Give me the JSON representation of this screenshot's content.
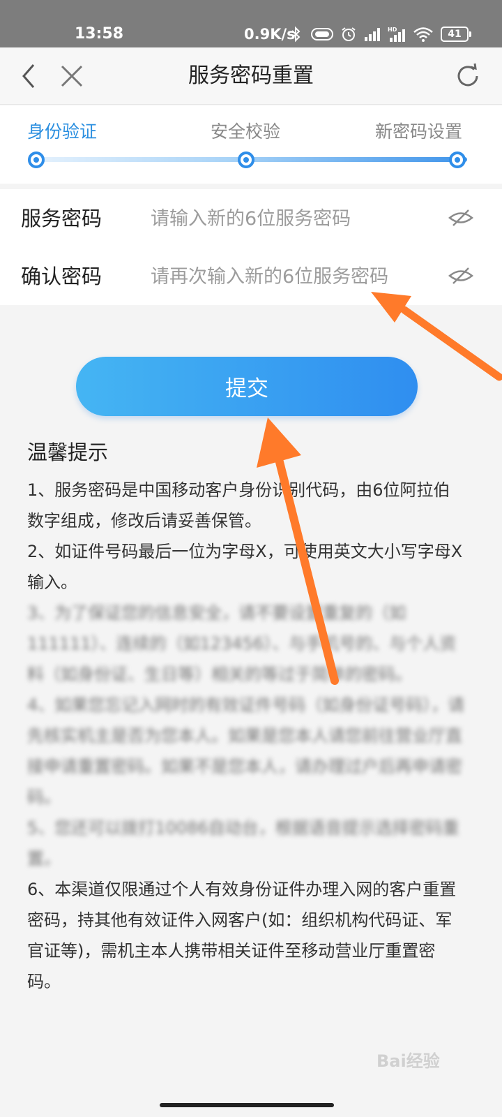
{
  "status_bar": {
    "time": "13:58",
    "network_speed": "0.9K/s",
    "battery_level": "41"
  },
  "nav": {
    "title": "服务密码重置",
    "back_icon": "chevron-left-icon",
    "close_icon": "close-icon",
    "refresh_icon": "refresh-icon"
  },
  "steps": {
    "items": [
      {
        "label": "身份验证",
        "active": true
      },
      {
        "label": "安全校验",
        "active": false
      },
      {
        "label": "新密码设置",
        "active": false
      }
    ],
    "active_color": "#2b8fe0"
  },
  "form": {
    "password": {
      "label": "服务密码",
      "placeholder": "请输入新的6位服务密码",
      "value": ""
    },
    "confirm": {
      "label": "确认密码",
      "placeholder": "请再次输入新的6位服务密码",
      "value": ""
    }
  },
  "submit_label": "提交",
  "tips": {
    "title": "温馨提示",
    "items": [
      "1、服务密码是中国移动客户身份识别代码，由6位阿拉伯数字组成，修改后请妥善保管。",
      "2、如证件号码最后一位为字母X，可使用英文大小写字母X输入。",
      "3、为了保证您的信息安全，请不要设置重复的（如111111）、连续的（如123456）、与手机号的、与个人资料（如身份证、生日等）相关的等过于简单的密码。",
      "4、如果您忘记入网时的有效证件号码（如身份证号码），请先核实机主是否为您本人。如果是您本人请您前往营业厅直接申请重置密码。如果不是您本人，请办理过户后再申请密码。",
      "5、您还可以拨打10086自动台，根据语音提示选择密码重置。",
      "6、本渠道仅限通过个人有效身份证件办理入网的客户重置密码，持其他有效证件入网客户(如：组织机构代码证、军官证等)，需机主本人携带相关证件至移动营业厅重置密码。"
    ]
  },
  "annotation_color": "#ff7a2a",
  "watermark": "Bai经验"
}
